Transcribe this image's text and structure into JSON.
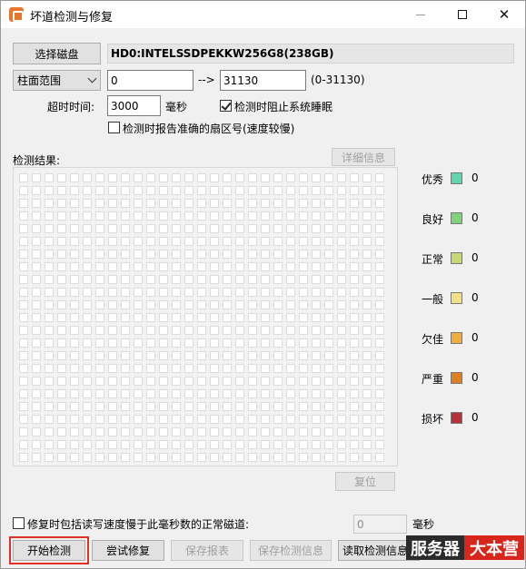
{
  "window": {
    "title": "坏道检测与修复",
    "controls": {
      "minimize": "—",
      "maximize": "□",
      "close": "✕"
    }
  },
  "disk": {
    "select_button": "选择磁盘",
    "name": "HD0:INTELSSDPEKKW256G8(238GB)"
  },
  "range": {
    "mode": "柱面范围",
    "start": "0",
    "arrow": "-->",
    "end": "31130",
    "hint": "(0-31130)"
  },
  "timeout": {
    "label": "超时时间:",
    "value": "3000",
    "unit": "毫秒"
  },
  "options": {
    "prevent_sleep": {
      "label": "检测时阻止系统睡眠",
      "checked": true
    },
    "report_sector": {
      "label": "检测时报告准确的扇区号(速度较慢)",
      "checked": false
    }
  },
  "results": {
    "label": "检测结果:",
    "details_button": "详细信息",
    "reset_button": "复位"
  },
  "legend": [
    {
      "label": "优秀",
      "color": "#5fd5b0",
      "count": "0"
    },
    {
      "label": "良好",
      "color": "#7fd47a",
      "count": "0"
    },
    {
      "label": "正常",
      "color": "#c6d873",
      "count": "0"
    },
    {
      "label": "一般",
      "color": "#f2e085",
      "count": "0"
    },
    {
      "label": "欠佳",
      "color": "#f2ad3c",
      "count": "0"
    },
    {
      "label": "严重",
      "color": "#df7f1e",
      "count": "0"
    },
    {
      "label": "损坏",
      "color": "#b8303a",
      "count": "0"
    }
  ],
  "repair_option": {
    "label": "修复时包括读写速度慢于此毫秒数的正常磁道:",
    "value": "0",
    "unit": "毫秒",
    "checked": false
  },
  "actions": {
    "start": "开始检测",
    "try_repair": "尝试修复",
    "save_report": "保存报表",
    "save_info": "保存检测信息",
    "load_info": "读取检测信息"
  },
  "watermark": {
    "part1": "服务器",
    "part2": "大本营"
  }
}
